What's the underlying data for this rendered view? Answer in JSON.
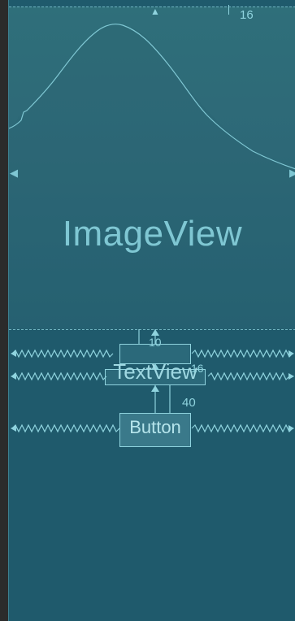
{
  "image_view": {
    "label": "ImageView"
  },
  "text_view": {
    "label": "TextView"
  },
  "button": {
    "label": "Button"
  },
  "margins": {
    "top": "16",
    "between": "40",
    "small_a": "10",
    "small_b": "16"
  },
  "colors": {
    "canvas": "#1f5a6c",
    "accent": "#8fd3de",
    "image_fill": "#2d6877"
  },
  "icons": [
    "anchor-arrow-icon",
    "spring-constraint-icon",
    "chevron-left-icon",
    "chevron-right-icon"
  ]
}
